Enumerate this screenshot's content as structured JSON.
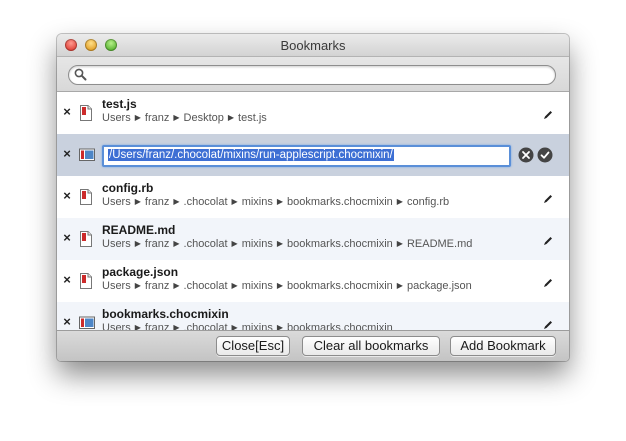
{
  "window": {
    "title": "Bookmarks"
  },
  "search": {
    "value": "",
    "placeholder": ""
  },
  "bookmarks": [
    {
      "name": "test.js",
      "path": [
        "Users",
        "franz",
        "Desktop",
        "test.js"
      ],
      "icon": "file-red-icon"
    },
    {
      "editing": true,
      "edit_value": "/Users/franz/.chocolat/mixins/run-applescript.chocmixin/",
      "icon": "folder-blue-icon"
    },
    {
      "name": "config.rb",
      "path": [
        "Users",
        "franz",
        ".chocolat",
        "mixins",
        "bookmarks.chocmixin",
        "config.rb"
      ],
      "icon": "file-red-icon"
    },
    {
      "name": "README.md",
      "path": [
        "Users",
        "franz",
        ".chocolat",
        "mixins",
        "bookmarks.chocmixin",
        "README.md"
      ],
      "icon": "file-red-icon"
    },
    {
      "name": "package.json",
      "path": [
        "Users",
        "franz",
        ".chocolat",
        "mixins",
        "bookmarks.chocmixin",
        "package.json"
      ],
      "icon": "file-red-icon"
    },
    {
      "name": "bookmarks.chocmixin",
      "path": [
        "Users",
        "franz",
        ".chocolat",
        "mixins",
        "bookmarks.chocmixin"
      ],
      "icon": "folder-blue-icon"
    }
  ],
  "footer": {
    "close_label": "Close[Esc]",
    "clear_label": "Clear all bookmarks",
    "add_label": "Add Bookmark"
  },
  "colors": {
    "selection": "#3d6fd4",
    "editing_row": "#c9d1de",
    "alt_row": "#f2f5fa"
  }
}
